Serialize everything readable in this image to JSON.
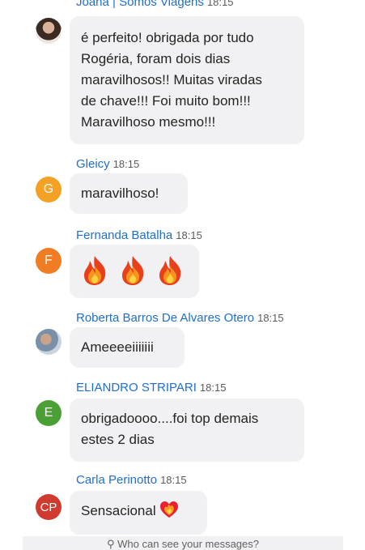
{
  "messages": [
    {
      "sender": "Joana | Somos Viagens",
      "time": "18:15",
      "lines": [
        "é perfeito! obrigada por tudo",
        "Rogéria, foram dois dias",
        "maravilhosos!! Muitas viradas",
        "de chave!!! Foi muito bom!!!",
        "Maravilhoso mesmo!!!"
      ]
    },
    {
      "sender": "Gleicy",
      "time": "18:15",
      "avatar_initial": "G",
      "avatar_color": "#f4a125",
      "text": "maravilhoso!"
    },
    {
      "sender": "Fernanda Batalha",
      "time": "18:15",
      "avatar_initial": "F",
      "avatar_color": "#f07d24",
      "emoji": "fire",
      "emoji_count": 3
    },
    {
      "sender": "Roberta Barros De Alvares Otero",
      "time": "18:15",
      "text": "Ameeeeiiiiiii"
    },
    {
      "sender": "ELIANDRO STRIPARI",
      "time": "18:15",
      "avatar_initial": "E",
      "avatar_color": "#4aa035",
      "lines": [
        "obrigadoooo....foi top demais",
        "estes 2 dias"
      ]
    },
    {
      "sender": "Carla Perinotto",
      "time": "18:15",
      "avatar_initial": "CP",
      "avatar_color": "#d13a2f",
      "text": "Sensacional",
      "emoji": "heart-on-fire"
    }
  ],
  "footer": {
    "hint": "Who can see your messages?"
  }
}
